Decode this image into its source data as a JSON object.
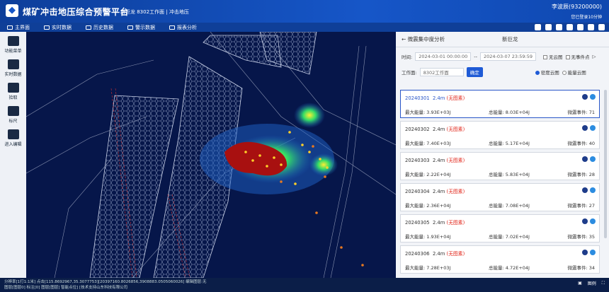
{
  "header": {
    "title": "煤矿冲击地压综合预警平台",
    "subtitle": "新巨龙 8302工作面 | 冲击地压",
    "user": "李波辰(93200000)",
    "login": "您已登录10分钟"
  },
  "nav": {
    "items": [
      "主界面",
      "实时数据",
      "历史数据",
      "警示数据",
      "报表分析"
    ]
  },
  "sidebar": {
    "items": [
      "功能菜单",
      "实时数据",
      "拾取",
      "标尺",
      "进入编辑"
    ]
  },
  "panel": {
    "back_label": "微震集中度分析",
    "center_title": "新巨龙",
    "time_label": "时间:",
    "start": "2024-03-01 00:00:00",
    "sep": "--",
    "end": "2024-03-07 23:59:59",
    "chk1": "无云图",
    "chk2": "无事件点",
    "face_label": "工作面:",
    "face_value": "8302工作面",
    "confirm": "确定",
    "radio1": "密度云图",
    "radio2": "能量云图",
    "cards": [
      {
        "date": "20240301",
        "depth": "2.4m",
        "note": "(无图素)",
        "max": "最大能量: 3.93E+03J",
        "total": "总能量: 8.03E+04J",
        "count": "微震事件: 71"
      },
      {
        "date": "20240302",
        "depth": "2.4m",
        "note": "(无图素)",
        "max": "最大能量: 7.40E+03J",
        "total": "总能量: 5.17E+04J",
        "count": "微震事件: 40"
      },
      {
        "date": "20240303",
        "depth": "2.4m",
        "note": "(无图素)",
        "max": "最大能量: 2.22E+04J",
        "total": "总能量: 5.83E+04J",
        "count": "微震事件: 28"
      },
      {
        "date": "20240304",
        "depth": "2.4m",
        "note": "(无图素)",
        "max": "最大能量: 2.36E+04J",
        "total": "总能量: 7.08E+04J",
        "count": "微震事件: 27"
      },
      {
        "date": "20240305",
        "depth": "2.4m",
        "note": "(无图素)",
        "max": "最大能量: 1.93E+04J",
        "total": "总能量: 7.02E+04J",
        "count": "微震事件: 35"
      },
      {
        "date": "20240306",
        "depth": "2.4m",
        "note": "(无图素)",
        "max": "最大能量: 7.28E+03J",
        "total": "总能量: 4.72E+04J",
        "count": "微震事件: 34"
      }
    ]
  },
  "status": {
    "line1": "分辨率[1打1:1米] 点击[115.8692967,35.3077753][20397160.8026856,3908883.0505060026] 编辑图层:无",
    "line2": "图层[图层0] 标注[0] 图层[图层] 智能点位] [技术支持山东科技有限公司",
    "legend": "图例"
  }
}
